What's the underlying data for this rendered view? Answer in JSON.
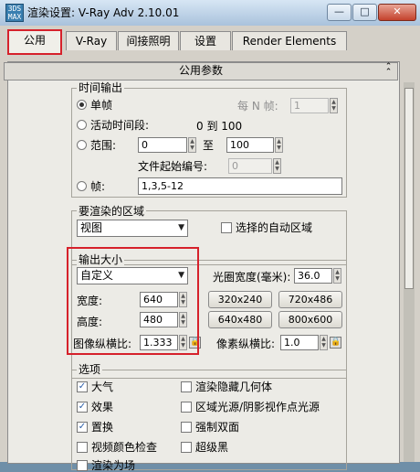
{
  "window": {
    "app_icon_text": "3DS MAX",
    "title": "渲染设置: V-Ray Adv 2.10.01",
    "buttons": [
      "—",
      "□",
      "✕"
    ]
  },
  "tabs": [
    {
      "label": "公用",
      "active": true
    },
    {
      "label": "V-Ray",
      "active": false
    },
    {
      "label": "间接照明",
      "active": false
    },
    {
      "label": "设置",
      "active": false
    },
    {
      "label": "Render Elements",
      "active": false
    }
  ],
  "rollout": {
    "title": "公用参数",
    "collapse_icon": "chevron-up-double-icon"
  },
  "time_output": {
    "title": "时间输出",
    "single": "单帧",
    "every_n_label": "每 N 帧:",
    "every_n_value": "1",
    "active_segment": "活动时间段:",
    "active_segment_range": "0 到 100",
    "range": "范围:",
    "range_from": "0",
    "range_to_label": "至",
    "range_to": "100",
    "file_start_label": "文件起始编号:",
    "file_start_value": "0",
    "frames": "帧:",
    "frames_value": "1,3,5-12",
    "selected": "单帧"
  },
  "render_area": {
    "title": "要渲染的区域",
    "dropdown": "视图",
    "auto_region_label": "选择的自动区域",
    "auto_region_checked": false
  },
  "output_size": {
    "title": "输出大小",
    "preset": "自定义",
    "aperture_label": "光圈宽度(毫米):",
    "aperture_value": "36.0",
    "width_label": "宽度:",
    "width_value": "640",
    "height_label": "高度:",
    "height_value": "480",
    "presets": [
      "320x240",
      "720x486",
      "640x480",
      "800x600"
    ],
    "image_aspect_label": "图像纵横比:",
    "image_aspect_value": "1.333",
    "pixel_aspect_label": "像素纵横比:",
    "pixel_aspect_value": "1.0"
  },
  "options": {
    "title": "选项",
    "items": [
      {
        "label": "大气",
        "checked": true
      },
      {
        "label": "渲染隐藏几何体",
        "checked": false
      },
      {
        "label": "效果",
        "checked": true
      },
      {
        "label": "区域光源/阴影视作点光源",
        "checked": false
      },
      {
        "label": "置换",
        "checked": true
      },
      {
        "label": "强制双面",
        "checked": false
      },
      {
        "label": "视频颜色检查",
        "checked": false
      },
      {
        "label": "超级黑",
        "checked": false
      },
      {
        "label": "渲染为场",
        "checked": false
      }
    ]
  },
  "colors": {
    "highlight_border": "#d6212b",
    "panel_bg": "#ecebe6",
    "title_bar": "#b9cfe5"
  }
}
